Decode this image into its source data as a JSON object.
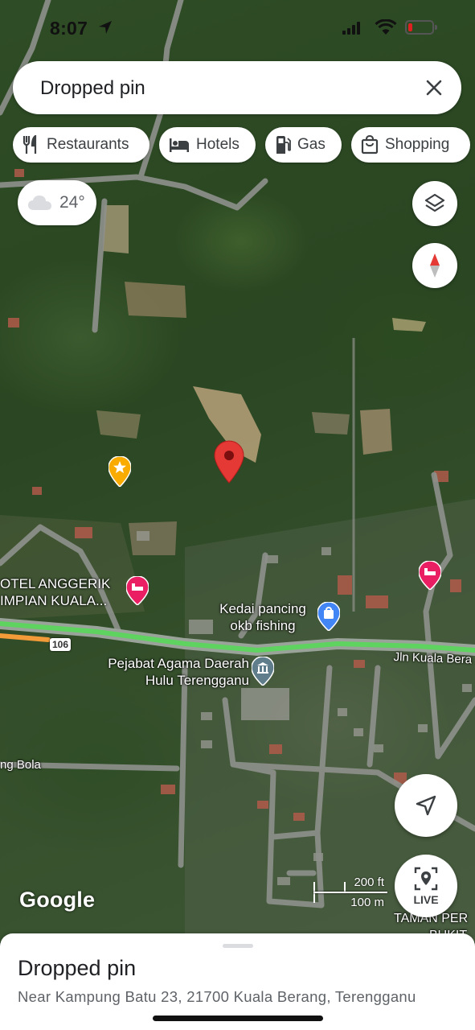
{
  "status_bar": {
    "time": "8:07"
  },
  "search": {
    "text": "Dropped pin"
  },
  "category_chips": [
    {
      "label": "Restaurants",
      "icon": "fork-knife-icon"
    },
    {
      "label": "Hotels",
      "icon": "bed-icon"
    },
    {
      "label": "Gas",
      "icon": "gas-pump-icon"
    },
    {
      "label": "Shopping",
      "icon": "shopping-bag-icon"
    }
  ],
  "weather": {
    "temperature": "24°",
    "icon": "cloud-icon"
  },
  "map": {
    "view": "satellite",
    "labels": {
      "hotel_line1": "OTEL ANGGERIK",
      "hotel_line2": "IMPIAN KUALA...",
      "shop_line1": "Kedai pancing",
      "shop_line2": "okb fishing",
      "office_line1": "Pejabat Agama Daerah",
      "office_line2": "Hulu Terengganu",
      "road_jln": "Jln Kuala Bera",
      "road_shield": "106",
      "road_bola": "ng Bola",
      "taman_line1": "TAMAN PER",
      "taman_line2": "BUKIT"
    },
    "colors": {
      "pin": "#e53935",
      "hotel_poi": "#e91e63",
      "shop_poi": "#4285f4",
      "office_poi": "#607d8b",
      "saved_star": "#f9ab00",
      "traffic_green": "#5fd35f"
    }
  },
  "scale": {
    "ft": "200 ft",
    "m": "100 m"
  },
  "buttons": {
    "live": "LIVE"
  },
  "branding": {
    "google": "Google"
  },
  "bottom_sheet": {
    "title": "Dropped pin",
    "address": "Near Kampung Batu 23, 21700 Kuala Berang, Terengganu"
  }
}
